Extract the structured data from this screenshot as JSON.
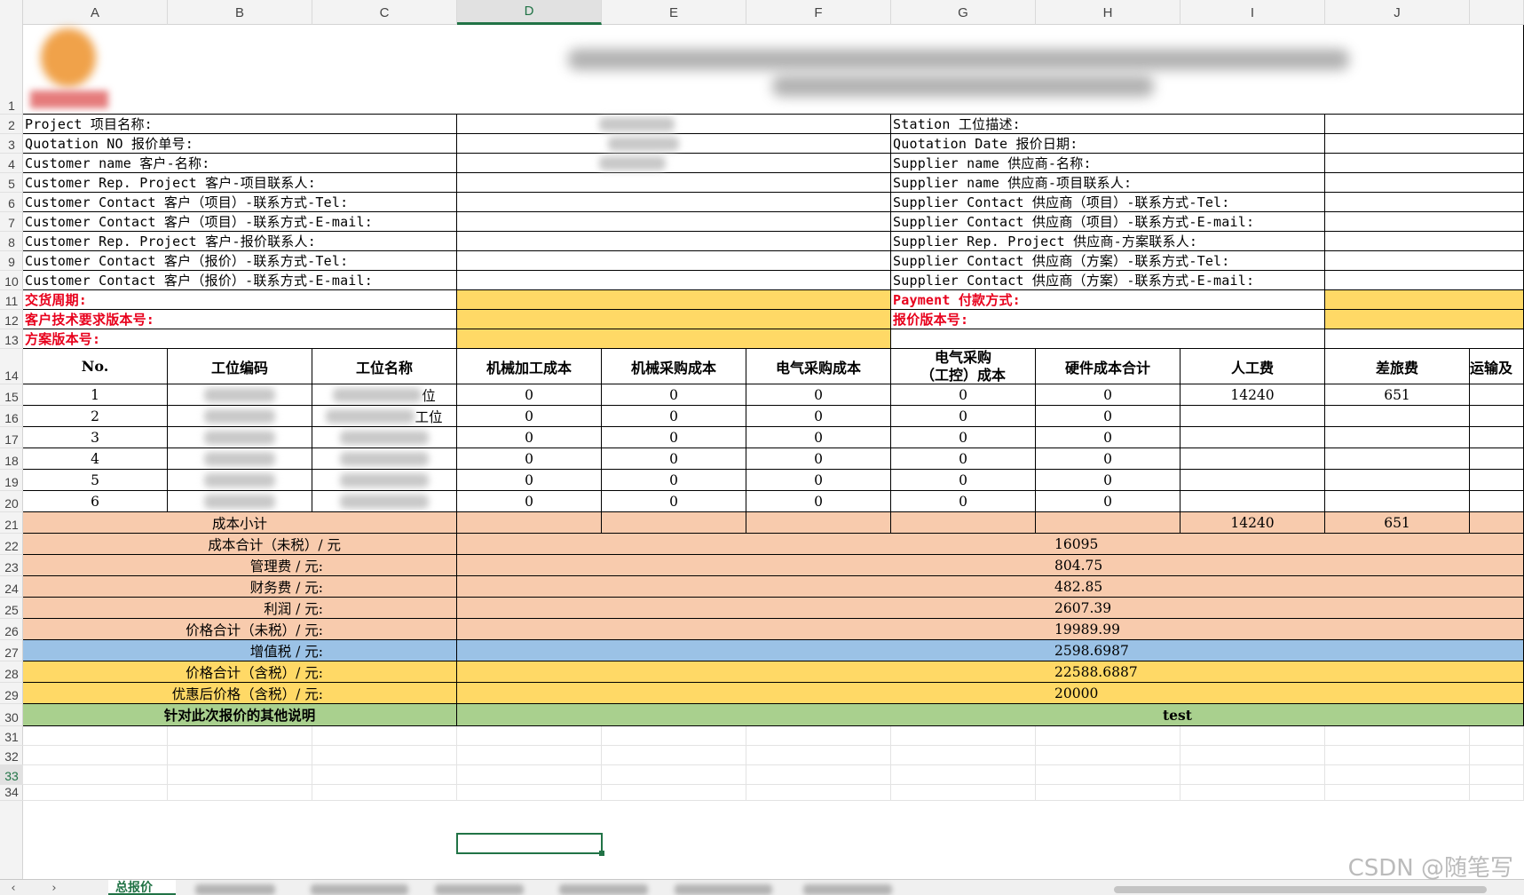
{
  "columns": [
    "A",
    "B",
    "C",
    "D",
    "E",
    "F",
    "G",
    "H",
    "I",
    "J"
  ],
  "active_column": "D",
  "rows": [
    "1",
    "2",
    "3",
    "4",
    "5",
    "6",
    "7",
    "8",
    "9",
    "10",
    "11",
    "12",
    "13",
    "14",
    "15",
    "16",
    "17",
    "18",
    "19",
    "20",
    "21",
    "22",
    "23",
    "24",
    "25",
    "26",
    "27",
    "28",
    "29",
    "30",
    "31",
    "32",
    "33",
    "34"
  ],
  "active_row": "33",
  "info_left": [
    "Project 项目名称:",
    "Quotation NO 报价单号:",
    "Customer name 客户-名称:",
    "Customer Rep. Project 客户-项目联系人:",
    "Customer Contact 客户（项目）-联系方式-Tel:",
    "Customer Contact 客户（项目）-联系方式-E-mail:",
    "Customer Rep. Project 客户-报价联系人:",
    "Customer Contact 客户（报价）-联系方式-Tel:",
    "Customer Contact 客户（报价）-联系方式-E-mail:"
  ],
  "info_right": [
    "Station 工位描述:",
    "Quotation Date 报价日期:",
    "Supplier name 供应商-名称:",
    "Supplier name 供应商-项目联系人:",
    "Supplier Contact 供应商（项目）-联系方式-Tel:",
    "Supplier Contact 供应商（项目）-联系方式-E-mail:",
    "Supplier Rep. Project 供应商-方案联系人:",
    "Supplier Contact 供应商（方案）-联系方式-Tel:",
    "Supplier Contact 供应商（方案）-联系方式-E-mail:"
  ],
  "red_labels": {
    "delivery": "交货周期:",
    "payment": "Payment 付款方式:",
    "cust_version": "客户技术要求版本号:",
    "quote_version": "报价版本号:",
    "plan_version": "方案版本号:"
  },
  "table_headers": {
    "no": "No.",
    "station_code": "工位编码",
    "station_name": "工位名称",
    "mech_machining": "机械加工成本",
    "mech_purchase": "机械采购成本",
    "elec_purchase": "电气采购成本",
    "elec_station_line1": "电气采购",
    "elec_station_line2": "（工控）成本",
    "hw_total": "硬件成本合计",
    "labor": "人工费",
    "travel": "差旅费",
    "transport": "运输及"
  },
  "table_rows": [
    {
      "no": "1",
      "d": "0",
      "e": "0",
      "f": "0",
      "g": "0",
      "h": "0",
      "i": "14240",
      "j": "651",
      "name_tail": "位"
    },
    {
      "no": "2",
      "d": "0",
      "e": "0",
      "f": "0",
      "g": "0",
      "h": "0",
      "i": "",
      "j": "",
      "name_tail": "工位"
    },
    {
      "no": "3",
      "d": "0",
      "e": "0",
      "f": "0",
      "g": "0",
      "h": "0",
      "i": "",
      "j": "",
      "name_tail": ""
    },
    {
      "no": "4",
      "d": "0",
      "e": "0",
      "f": "0",
      "g": "0",
      "h": "0",
      "i": "",
      "j": "",
      "name_tail": ""
    },
    {
      "no": "5",
      "d": "0",
      "e": "0",
      "f": "0",
      "g": "0",
      "h": "0",
      "i": "",
      "j": "",
      "name_tail": ""
    },
    {
      "no": "6",
      "d": "0",
      "e": "0",
      "f": "0",
      "g": "0",
      "h": "0",
      "i": "",
      "j": "",
      "name_tail": ""
    }
  ],
  "subtotal": {
    "label": "成本小计",
    "i": "14240",
    "j": "651"
  },
  "summary": [
    {
      "label": "成本合计（未税）/ 元",
      "value": "16095",
      "color": "orange"
    },
    {
      "label": "管理费 / 元:",
      "value": "804.75",
      "color": "orange"
    },
    {
      "label": "财务费 / 元:",
      "value": "482.85",
      "color": "orange"
    },
    {
      "label": "利润 / 元:",
      "value": "2607.39",
      "color": "orange"
    },
    {
      "label": "价格合计（未税）/ 元:",
      "value": "19989.99",
      "color": "orange"
    },
    {
      "label": "增值税 / 元:",
      "value": "2598.6987",
      "color": "blue"
    },
    {
      "label": "价格合计（含税）/ 元:",
      "value": "22588.6887",
      "color": "yellow"
    },
    {
      "label": "优惠后价格（含税）/ 元:",
      "value": "20000",
      "color": "yellow"
    }
  ],
  "remarks": {
    "label": "针对此次报价的其他说明",
    "value": "test"
  },
  "sheet_tabs": {
    "active": "总报价"
  },
  "colors": {
    "orange": "#f8cbad",
    "yellow": "#ffd966",
    "blue": "#9bc2e6",
    "green": "#a9d08e",
    "red_text": "#e8001c",
    "accent": "#217346"
  },
  "watermark": "CSDN @随笔写"
}
